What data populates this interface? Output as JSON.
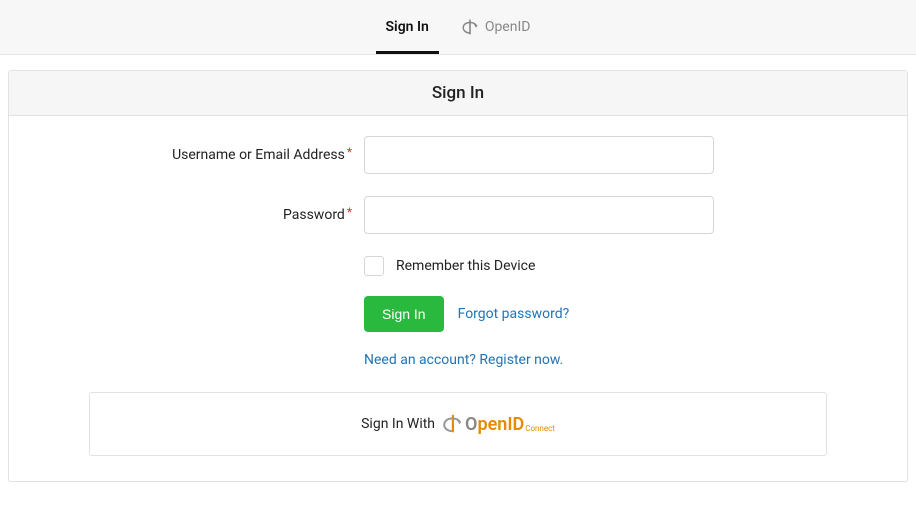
{
  "tabs": {
    "signin": "Sign In",
    "openid": "OpenID"
  },
  "card": {
    "title": "Sign In"
  },
  "form": {
    "username_label": "Username or Email Address",
    "password_label": "Password",
    "remember_label": "Remember this Device",
    "submit_label": "Sign In",
    "forgot_label": "Forgot password?",
    "register_label": "Need an account? Register now."
  },
  "provider": {
    "prefix": "Sign In With",
    "logo_o": "O",
    "logo_penid": "penID",
    "logo_connect": "Connect"
  }
}
